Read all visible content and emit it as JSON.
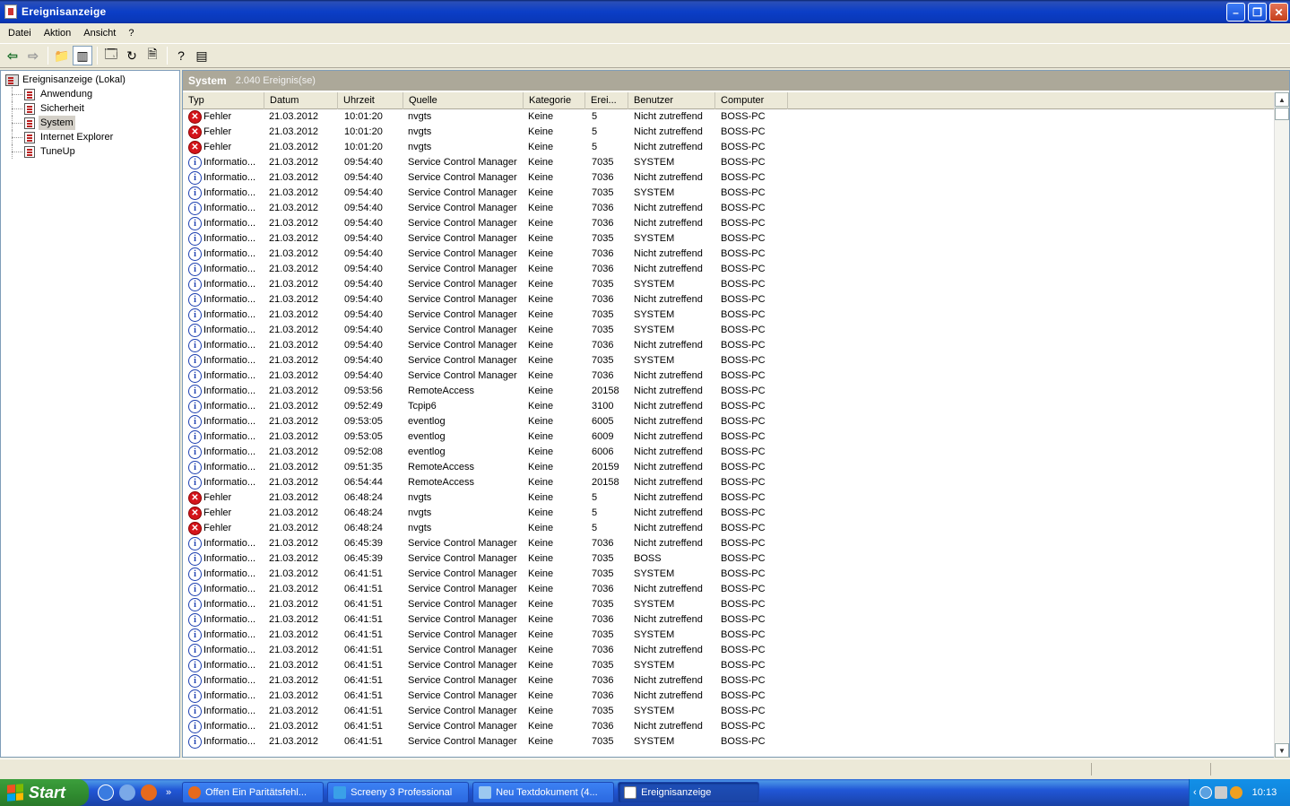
{
  "window": {
    "title": "Ereignisanzeige"
  },
  "menu": [
    "Datei",
    "Aktion",
    "Ansicht",
    "?"
  ],
  "tree": {
    "root": "Ereignisanzeige (Lokal)",
    "children": [
      "Anwendung",
      "Sicherheit",
      "System",
      "Internet Explorer",
      "TuneUp"
    ],
    "selected": "System"
  },
  "pane": {
    "title": "System",
    "count": "2.040 Ereignis(se)"
  },
  "columns": [
    "Typ",
    "Datum",
    "Uhrzeit",
    "Quelle",
    "Kategorie",
    "Erei...",
    "Benutzer",
    "Computer"
  ],
  "rows": [
    [
      "Fehler",
      "21.03.2012",
      "10:01:20",
      "nvgts",
      "Keine",
      "5",
      "Nicht zutreffend",
      "BOSS-PC"
    ],
    [
      "Fehler",
      "21.03.2012",
      "10:01:20",
      "nvgts",
      "Keine",
      "5",
      "Nicht zutreffend",
      "BOSS-PC"
    ],
    [
      "Fehler",
      "21.03.2012",
      "10:01:20",
      "nvgts",
      "Keine",
      "5",
      "Nicht zutreffend",
      "BOSS-PC"
    ],
    [
      "Informatio...",
      "21.03.2012",
      "09:54:40",
      "Service Control Manager",
      "Keine",
      "7035",
      "SYSTEM",
      "BOSS-PC"
    ],
    [
      "Informatio...",
      "21.03.2012",
      "09:54:40",
      "Service Control Manager",
      "Keine",
      "7036",
      "Nicht zutreffend",
      "BOSS-PC"
    ],
    [
      "Informatio...",
      "21.03.2012",
      "09:54:40",
      "Service Control Manager",
      "Keine",
      "7035",
      "SYSTEM",
      "BOSS-PC"
    ],
    [
      "Informatio...",
      "21.03.2012",
      "09:54:40",
      "Service Control Manager",
      "Keine",
      "7036",
      "Nicht zutreffend",
      "BOSS-PC"
    ],
    [
      "Informatio...",
      "21.03.2012",
      "09:54:40",
      "Service Control Manager",
      "Keine",
      "7036",
      "Nicht zutreffend",
      "BOSS-PC"
    ],
    [
      "Informatio...",
      "21.03.2012",
      "09:54:40",
      "Service Control Manager",
      "Keine",
      "7035",
      "SYSTEM",
      "BOSS-PC"
    ],
    [
      "Informatio...",
      "21.03.2012",
      "09:54:40",
      "Service Control Manager",
      "Keine",
      "7036",
      "Nicht zutreffend",
      "BOSS-PC"
    ],
    [
      "Informatio...",
      "21.03.2012",
      "09:54:40",
      "Service Control Manager",
      "Keine",
      "7036",
      "Nicht zutreffend",
      "BOSS-PC"
    ],
    [
      "Informatio...",
      "21.03.2012",
      "09:54:40",
      "Service Control Manager",
      "Keine",
      "7035",
      "SYSTEM",
      "BOSS-PC"
    ],
    [
      "Informatio...",
      "21.03.2012",
      "09:54:40",
      "Service Control Manager",
      "Keine",
      "7036",
      "Nicht zutreffend",
      "BOSS-PC"
    ],
    [
      "Informatio...",
      "21.03.2012",
      "09:54:40",
      "Service Control Manager",
      "Keine",
      "7035",
      "SYSTEM",
      "BOSS-PC"
    ],
    [
      "Informatio...",
      "21.03.2012",
      "09:54:40",
      "Service Control Manager",
      "Keine",
      "7035",
      "SYSTEM",
      "BOSS-PC"
    ],
    [
      "Informatio...",
      "21.03.2012",
      "09:54:40",
      "Service Control Manager",
      "Keine",
      "7036",
      "Nicht zutreffend",
      "BOSS-PC"
    ],
    [
      "Informatio...",
      "21.03.2012",
      "09:54:40",
      "Service Control Manager",
      "Keine",
      "7035",
      "SYSTEM",
      "BOSS-PC"
    ],
    [
      "Informatio...",
      "21.03.2012",
      "09:54:40",
      "Service Control Manager",
      "Keine",
      "7036",
      "Nicht zutreffend",
      "BOSS-PC"
    ],
    [
      "Informatio...",
      "21.03.2012",
      "09:53:56",
      "RemoteAccess",
      "Keine",
      "20158",
      "Nicht zutreffend",
      "BOSS-PC"
    ],
    [
      "Informatio...",
      "21.03.2012",
      "09:52:49",
      "Tcpip6",
      "Keine",
      "3100",
      "Nicht zutreffend",
      "BOSS-PC"
    ],
    [
      "Informatio...",
      "21.03.2012",
      "09:53:05",
      "eventlog",
      "Keine",
      "6005",
      "Nicht zutreffend",
      "BOSS-PC"
    ],
    [
      "Informatio...",
      "21.03.2012",
      "09:53:05",
      "eventlog",
      "Keine",
      "6009",
      "Nicht zutreffend",
      "BOSS-PC"
    ],
    [
      "Informatio...",
      "21.03.2012",
      "09:52:08",
      "eventlog",
      "Keine",
      "6006",
      "Nicht zutreffend",
      "BOSS-PC"
    ],
    [
      "Informatio...",
      "21.03.2012",
      "09:51:35",
      "RemoteAccess",
      "Keine",
      "20159",
      "Nicht zutreffend",
      "BOSS-PC"
    ],
    [
      "Informatio...",
      "21.03.2012",
      "06:54:44",
      "RemoteAccess",
      "Keine",
      "20158",
      "Nicht zutreffend",
      "BOSS-PC"
    ],
    [
      "Fehler",
      "21.03.2012",
      "06:48:24",
      "nvgts",
      "Keine",
      "5",
      "Nicht zutreffend",
      "BOSS-PC"
    ],
    [
      "Fehler",
      "21.03.2012",
      "06:48:24",
      "nvgts",
      "Keine",
      "5",
      "Nicht zutreffend",
      "BOSS-PC"
    ],
    [
      "Fehler",
      "21.03.2012",
      "06:48:24",
      "nvgts",
      "Keine",
      "5",
      "Nicht zutreffend",
      "BOSS-PC"
    ],
    [
      "Informatio...",
      "21.03.2012",
      "06:45:39",
      "Service Control Manager",
      "Keine",
      "7036",
      "Nicht zutreffend",
      "BOSS-PC"
    ],
    [
      "Informatio...",
      "21.03.2012",
      "06:45:39",
      "Service Control Manager",
      "Keine",
      "7035",
      "BOSS",
      "BOSS-PC"
    ],
    [
      "Informatio...",
      "21.03.2012",
      "06:41:51",
      "Service Control Manager",
      "Keine",
      "7035",
      "SYSTEM",
      "BOSS-PC"
    ],
    [
      "Informatio...",
      "21.03.2012",
      "06:41:51",
      "Service Control Manager",
      "Keine",
      "7036",
      "Nicht zutreffend",
      "BOSS-PC"
    ],
    [
      "Informatio...",
      "21.03.2012",
      "06:41:51",
      "Service Control Manager",
      "Keine",
      "7035",
      "SYSTEM",
      "BOSS-PC"
    ],
    [
      "Informatio...",
      "21.03.2012",
      "06:41:51",
      "Service Control Manager",
      "Keine",
      "7036",
      "Nicht zutreffend",
      "BOSS-PC"
    ],
    [
      "Informatio...",
      "21.03.2012",
      "06:41:51",
      "Service Control Manager",
      "Keine",
      "7035",
      "SYSTEM",
      "BOSS-PC"
    ],
    [
      "Informatio...",
      "21.03.2012",
      "06:41:51",
      "Service Control Manager",
      "Keine",
      "7036",
      "Nicht zutreffend",
      "BOSS-PC"
    ],
    [
      "Informatio...",
      "21.03.2012",
      "06:41:51",
      "Service Control Manager",
      "Keine",
      "7035",
      "SYSTEM",
      "BOSS-PC"
    ],
    [
      "Informatio...",
      "21.03.2012",
      "06:41:51",
      "Service Control Manager",
      "Keine",
      "7036",
      "Nicht zutreffend",
      "BOSS-PC"
    ],
    [
      "Informatio...",
      "21.03.2012",
      "06:41:51",
      "Service Control Manager",
      "Keine",
      "7036",
      "Nicht zutreffend",
      "BOSS-PC"
    ],
    [
      "Informatio...",
      "21.03.2012",
      "06:41:51",
      "Service Control Manager",
      "Keine",
      "7035",
      "SYSTEM",
      "BOSS-PC"
    ],
    [
      "Informatio...",
      "21.03.2012",
      "06:41:51",
      "Service Control Manager",
      "Keine",
      "7036",
      "Nicht zutreffend",
      "BOSS-PC"
    ],
    [
      "Informatio...",
      "21.03.2012",
      "06:41:51",
      "Service Control Manager",
      "Keine",
      "7035",
      "SYSTEM",
      "BOSS-PC"
    ]
  ],
  "taskbar": {
    "start": "Start",
    "tasks": [
      "Offen Ein Paritätsfehl...",
      "Screeny 3 Professional",
      "Neu Textdokument (4...",
      "Ereignisanzeige"
    ],
    "active_task": 3,
    "clock": "10:13"
  },
  "colors": {
    "titlebar": "#0b3ec7",
    "error": "#d4141a",
    "info": "#1c3fb0",
    "taskbar": "#2157d7",
    "start": "#2f8a2f"
  }
}
